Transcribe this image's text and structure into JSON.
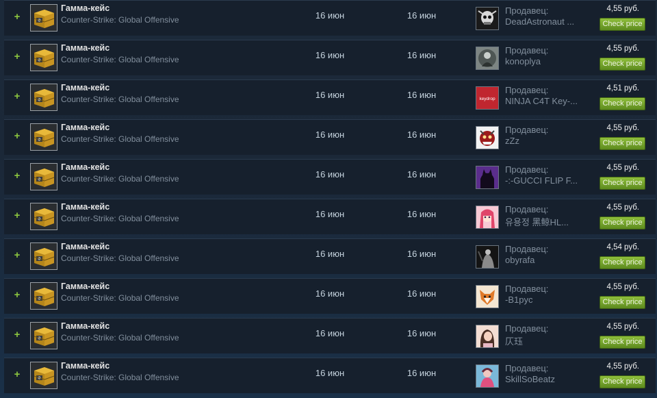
{
  "market": {
    "listings": [
      {
        "plus": "+",
        "item_name": "Гамма-кейс",
        "game": "Counter-Strike: Global Offensive",
        "listed_date": "16 июн",
        "acted_date": "16 июн",
        "seller_label": "Продавец:",
        "seller_name": "DeadAstronaut ...",
        "price": "4,55 руб.",
        "button": "Check price",
        "avatar_icon": "skull-avatar"
      },
      {
        "plus": "+",
        "item_name": "Гамма-кейс",
        "game": "Counter-Strike: Global Offensive",
        "listed_date": "16 июн",
        "acted_date": "16 июн",
        "seller_label": "Продавец:",
        "seller_name": "konoplya",
        "price": "4,55 руб.",
        "button": "Check price",
        "avatar_icon": "grey-figure-avatar"
      },
      {
        "plus": "+",
        "item_name": "Гамма-кейс",
        "game": "Counter-Strike: Global Offensive",
        "listed_date": "16 июн",
        "acted_date": "16 июн",
        "seller_label": "Продавец:",
        "seller_name": "NINJA C4T Key-...",
        "price": "4,51 руб.",
        "button": "Check price",
        "avatar_icon": "keydrop-logo-avatar",
        "avatar_text": "keydrop"
      },
      {
        "plus": "+",
        "item_name": "Гамма-кейс",
        "game": "Counter-Strike: Global Offensive",
        "listed_date": "16 июн",
        "acted_date": "16 июн",
        "seller_label": "Продавец:",
        "seller_name": "zZz",
        "price": "4,55 руб.",
        "button": "Check price",
        "avatar_icon": "monster-avatar"
      },
      {
        "plus": "+",
        "item_name": "Гамма-кейс",
        "game": "Counter-Strike: Global Offensive",
        "listed_date": "16 июн",
        "acted_date": "16 июн",
        "seller_label": "Продавец:",
        "seller_name": "-:-GUCCI FLIP F...",
        "price": "4,55 руб.",
        "button": "Check price",
        "avatar_icon": "purple-silhouette-avatar"
      },
      {
        "plus": "+",
        "item_name": "Гамма-кейс",
        "game": "Counter-Strike: Global Offensive",
        "listed_date": "16 июн",
        "acted_date": "16 июн",
        "seller_label": "Продавец:",
        "seller_name": "유용정 黑鲸HL...",
        "price": "4,55 руб.",
        "button": "Check price",
        "avatar_icon": "anime-girl-avatar"
      },
      {
        "plus": "+",
        "item_name": "Гамма-кейс",
        "game": "Counter-Strike: Global Offensive",
        "listed_date": "16 июн",
        "acted_date": "16 июн",
        "seller_label": "Продавец:",
        "seller_name": "obyrafa",
        "price": "4,54 руб.",
        "button": "Check price",
        "avatar_icon": "dark-figure-avatar"
      },
      {
        "plus": "+",
        "item_name": "Гамма-кейс",
        "game": "Counter-Strike: Global Offensive",
        "listed_date": "16 июн",
        "acted_date": "16 июн",
        "seller_label": "Продавец:",
        "seller_name": "-B1pyc",
        "price": "4,55 руб.",
        "button": "Check price",
        "avatar_icon": "fox-avatar"
      },
      {
        "plus": "+",
        "item_name": "Гамма-кейс",
        "game": "Counter-Strike: Global Offensive",
        "listed_date": "16 июн",
        "acted_date": "16 июн",
        "seller_label": "Продавец:",
        "seller_name": "仄珏",
        "price": "4,55 руб.",
        "button": "Check price",
        "avatar_icon": "girl-photo-avatar"
      },
      {
        "plus": "+",
        "item_name": "Гамма-кейс",
        "game": "Counter-Strike: Global Offensive",
        "listed_date": "16 июн",
        "acted_date": "16 июн",
        "seller_label": "Продавец:",
        "seller_name": "SkillSoBeatz",
        "price": "4,55 руб.",
        "button": "Check price",
        "avatar_icon": "pink-character-avatar"
      }
    ]
  },
  "colors": {
    "page_bg": "#1b2838",
    "row_bg": "#16202d",
    "plus_green": "#8bc53f",
    "button_green": "#75a52b",
    "muted_text": "#828f9d",
    "case_gold": "#d9a624"
  },
  "icons": {
    "item_icon": "gamma-case-icon",
    "add_icon": "plus-icon"
  }
}
